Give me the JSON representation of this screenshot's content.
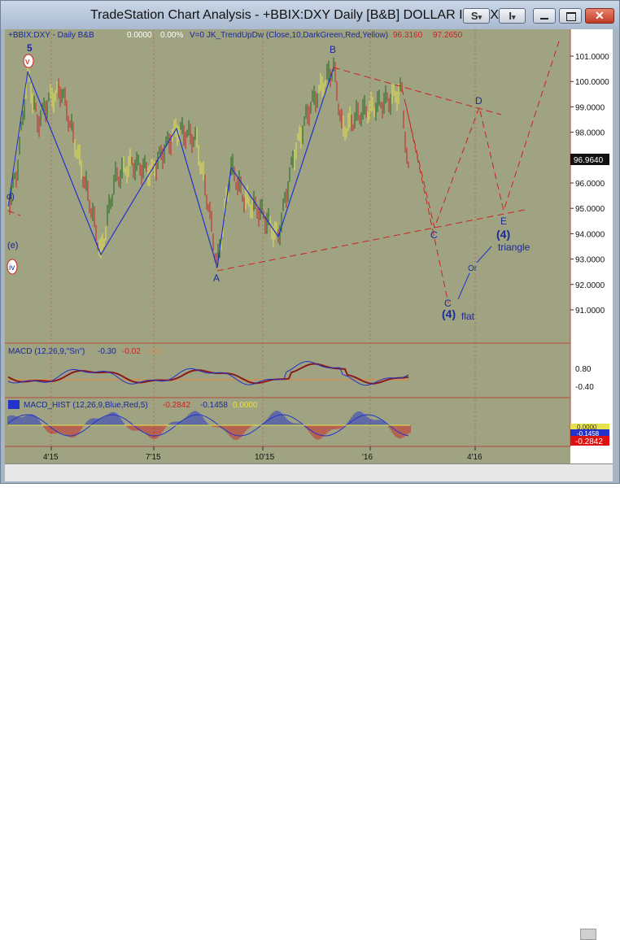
{
  "window": {
    "title": "TradeStation Chart Analysis - +BBIX:DXY Daily [B&B] DOLLAR INDEX",
    "s_button": "S",
    "i_button": "I",
    "dropdown_arrow": "▾"
  },
  "price_panel": {
    "header": {
      "symbol": "+BBIX:DXY - Daily  B&B",
      "change": "0.0000",
      "pct": "0.00%",
      "indicator": "V=0  JK_TrendUpDw (Close,10,DarkGreen,Red,Yellow)",
      "value1": "96.3160",
      "value2": "97.2650"
    },
    "price_labels": [
      "101.0000",
      "100.0000",
      "99.0000",
      "98.0000",
      "97.0000",
      "96.0000",
      "95.0000",
      "94.0000",
      "93.0000",
      "92.0000",
      "91.0000"
    ],
    "last_price": "96.9640",
    "wave_labels": {
      "five": "5",
      "v": "v",
      "b": "B",
      "a": "A",
      "c_mid": "C",
      "c_low": "C",
      "d": "D",
      "e": "E",
      "four_triangle": "(4)",
      "triangle": "triangle",
      "or": "Or",
      "four_flat": "(4)",
      "flat": "flat",
      "e_paren": "(e)",
      "iv": "iv",
      "d_left": "d)"
    }
  },
  "macd_panel": {
    "header": {
      "name": "MACD (12,26,9,\"Sn\")",
      "v1": "-0.30",
      "v2": "-0.02",
      "v3": "0.00"
    },
    "scale": [
      "0.80",
      "-0.40"
    ]
  },
  "hist_panel": {
    "header": {
      "name": "MACD_HIST (12,26,9,Blue,Red,5)",
      "v1": "-0.2842",
      "v2": "-0.1458",
      "v3": "0.0000"
    },
    "value_boxes": [
      "0.0000",
      "-0.1458",
      "-0.2842"
    ]
  },
  "time_axis": [
    "4'15",
    "7'15",
    "10'15",
    "'16",
    "4'16"
  ],
  "colors": {
    "chart_bg": "#9fa381",
    "up_bar": "#1a6a1a",
    "down_bar": "#cc2222",
    "neutral_bar": "#e6e34a",
    "wave_line": "#2233cc",
    "projection": "#cc2222",
    "grid": "#b64a3a"
  }
}
